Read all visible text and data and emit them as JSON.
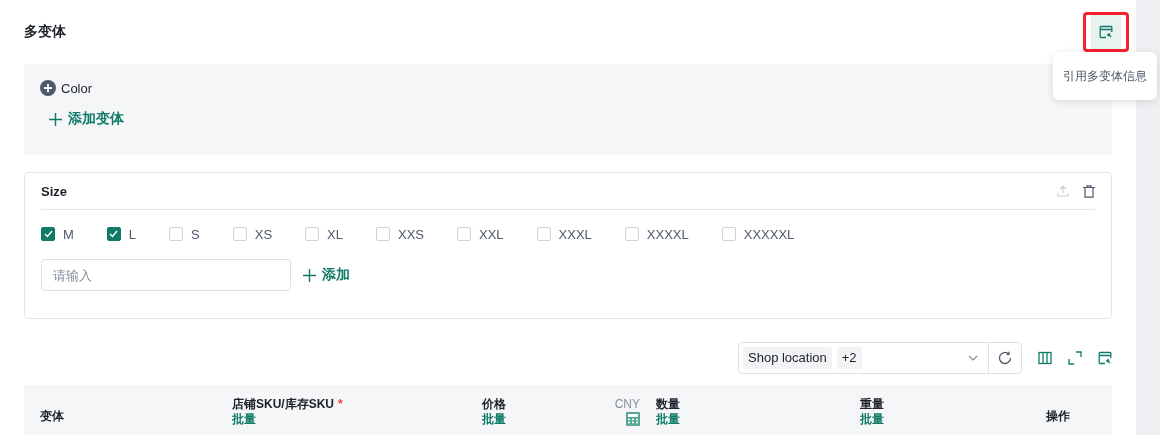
{
  "section": {
    "title": "多变体",
    "reference_button": {
      "highlighted": true
    },
    "tooltip": "引用多变体信息"
  },
  "color_group": {
    "name": "Color",
    "add_variant": "添加变体"
  },
  "size_group": {
    "name": "Size",
    "upload_disabled": true,
    "options": [
      {
        "label": "M",
        "checked": true
      },
      {
        "label": "L",
        "checked": true
      },
      {
        "label": "S",
        "checked": false
      },
      {
        "label": "XS",
        "checked": false
      },
      {
        "label": "XL",
        "checked": false
      },
      {
        "label": "XXS",
        "checked": false
      },
      {
        "label": "XXL",
        "checked": false
      },
      {
        "label": "XXXL",
        "checked": false
      },
      {
        "label": "XXXXL",
        "checked": false
      },
      {
        "label": "XXXXXL",
        "checked": false
      }
    ],
    "input": {
      "placeholder": "请输入"
    },
    "add": "添加"
  },
  "toolbar": {
    "select_tags": [
      "Shop location",
      "+2"
    ]
  },
  "table": {
    "columns": [
      {
        "title": "变体"
      },
      {
        "title": "店铺SKU/库存SKU",
        "required_mark": "*",
        "batch": "批量"
      },
      {
        "title": "价格",
        "batch": "批量",
        "currency": "CNY"
      },
      {
        "title": "数量",
        "batch": "批量"
      },
      {
        "title": "重量",
        "batch": "批量"
      },
      {
        "title": "操作"
      }
    ]
  }
}
